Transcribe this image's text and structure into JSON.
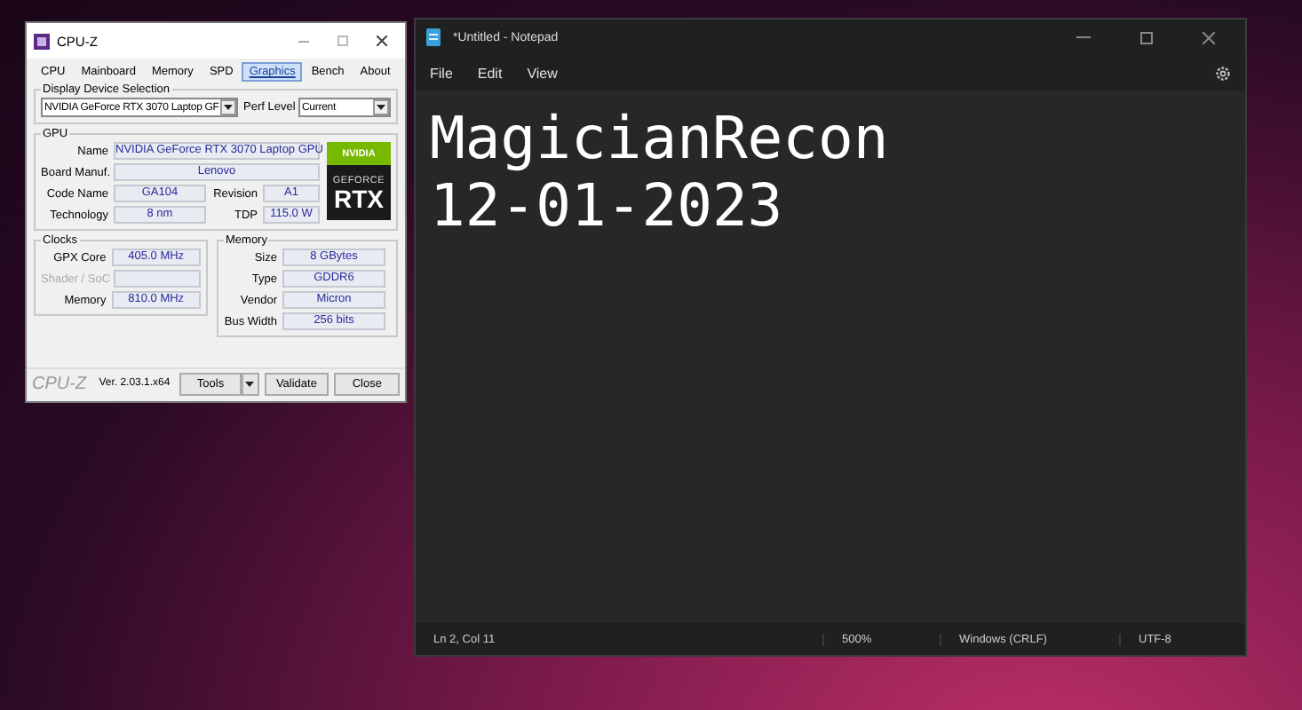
{
  "cpuz": {
    "title": "CPU-Z",
    "tabs": [
      {
        "label": "CPU",
        "selected": false
      },
      {
        "label": "Mainboard",
        "selected": false
      },
      {
        "label": "Memory",
        "selected": false
      },
      {
        "label": "SPD",
        "selected": false
      },
      {
        "label": "Graphics",
        "selected": true
      },
      {
        "label": "Bench",
        "selected": false
      },
      {
        "label": "About",
        "selected": false
      }
    ],
    "display_device_selection": {
      "label": "Display Device Selection",
      "device": "NVIDIA GeForce RTX 3070 Laptop GF",
      "perf_level_label": "Perf Level",
      "perf_level": "Current"
    },
    "gpu": {
      "label": "GPU",
      "name_label": "Name",
      "name": "NVIDIA GeForce RTX 3070 Laptop GPU",
      "board_label": "Board Manuf.",
      "board": "Lenovo",
      "pairs": [
        {
          "label": "Code Name",
          "value": "GA104",
          "label_2": "Revision",
          "value_2": "A1"
        },
        {
          "label": "Technology",
          "value": "8 nm",
          "label_2": "TDP",
          "value_2": "115.0 W"
        }
      ],
      "logo": {
        "brand": "NVIDIA",
        "line_1": "GEFORCE",
        "line_2": "RTX"
      }
    },
    "clocks": {
      "label": "Clocks",
      "rows": [
        {
          "label": "GPX Core",
          "value": "405.0 MHz",
          "disabled": false
        },
        {
          "label": "Shader / SoC",
          "disabled": true
        },
        {
          "label": "Memory",
          "value": "810.0 MHz",
          "disabled": false
        }
      ]
    },
    "memory": {
      "label": "Memory",
      "rows": [
        {
          "label": "Size",
          "value": "8 GBytes"
        },
        {
          "label": "Type",
          "value": "GDDR6"
        },
        {
          "label": "Vendor",
          "value": "Micron"
        },
        {
          "label": "Bus Width",
          "value": "256 bits"
        }
      ]
    },
    "footer": {
      "logo": "CPU-Z",
      "version": "Ver. 2.03.1.x64",
      "buttons": [
        "Tools",
        "Validate",
        "Close"
      ]
    }
  },
  "notepad": {
    "title": "*Untitled - Notepad",
    "menu": [
      "File",
      "Edit",
      "View"
    ],
    "lines": [
      "MagicianRecon",
      "12-01-2023"
    ],
    "status_bar": [
      "Ln 2, Col 11",
      "500%",
      "Windows (CRLF)",
      "UTF-8"
    ]
  }
}
